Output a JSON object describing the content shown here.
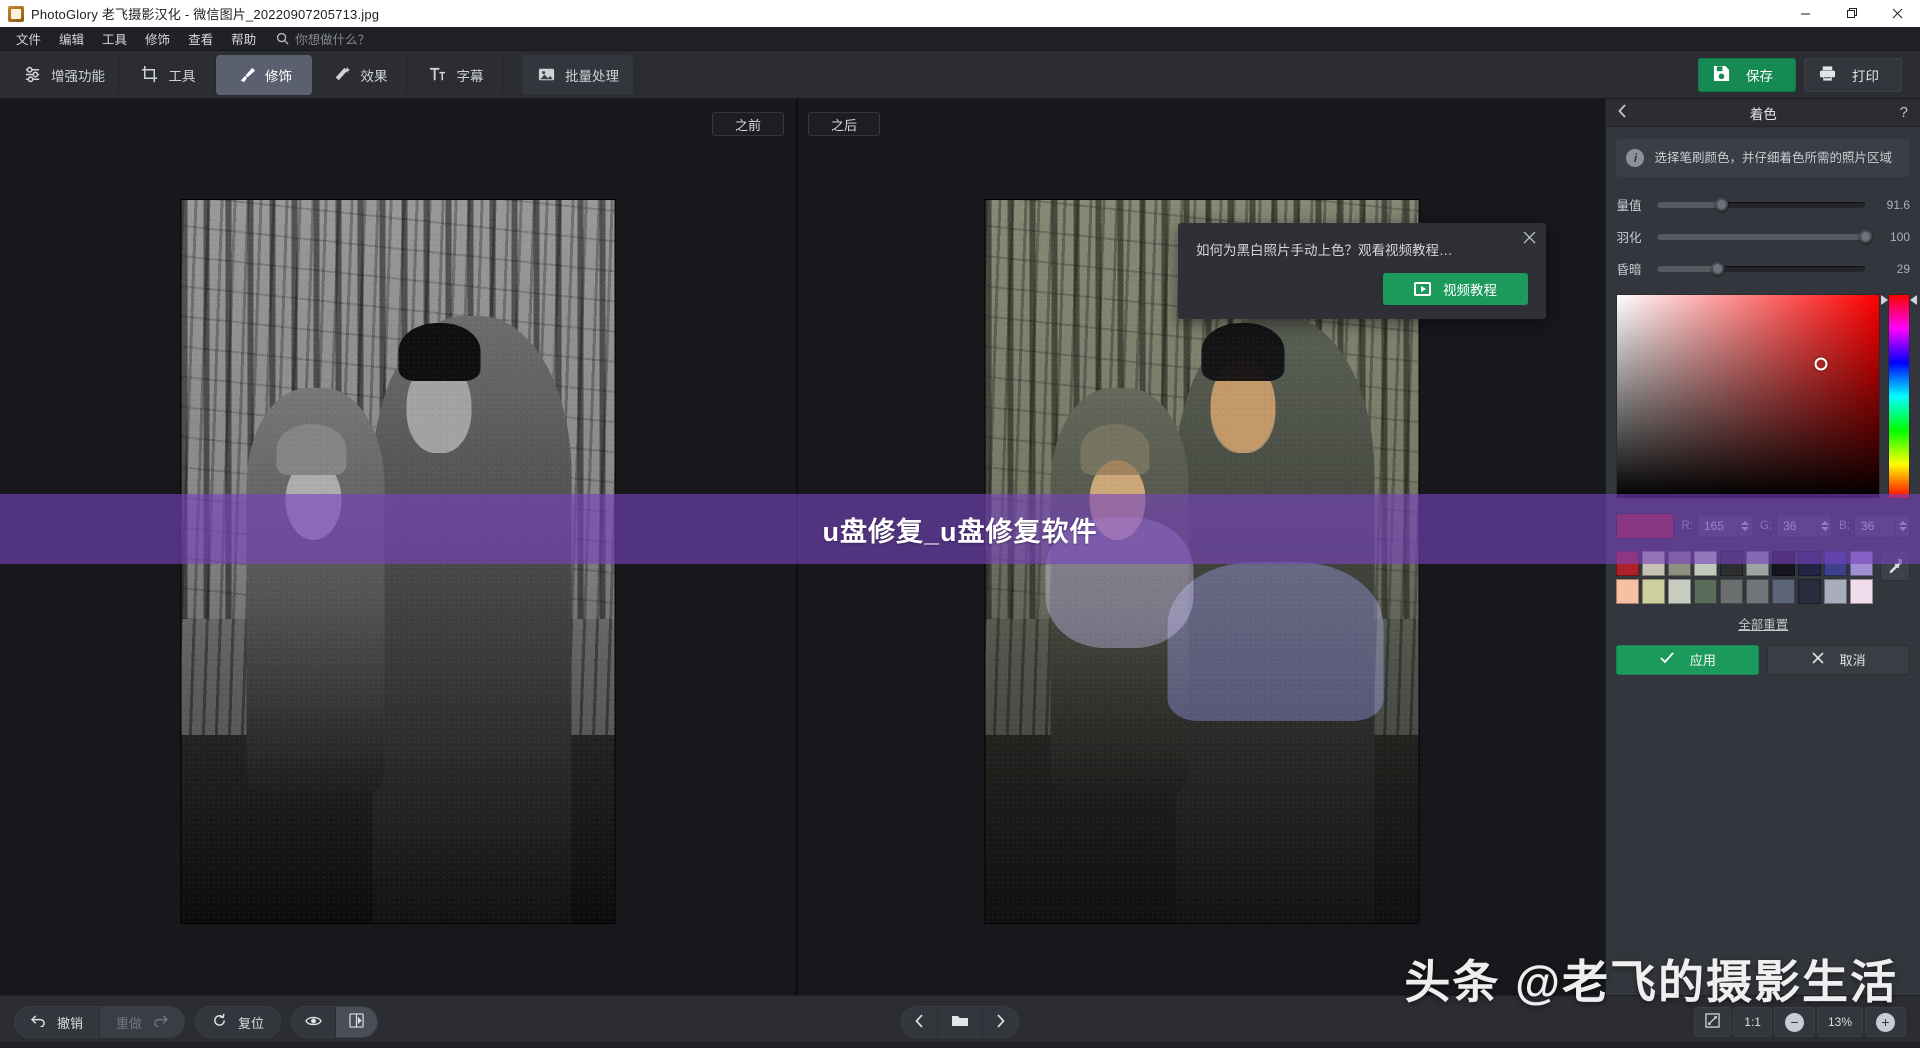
{
  "window": {
    "title": "PhotoGlory 老飞摄影汉化 - 微信图片_20220907205713.jpg",
    "app_icon": "photoglory-icon",
    "minimize": "—",
    "maximize": "❐",
    "close": "✕"
  },
  "menubar": {
    "items": [
      {
        "label": "文件"
      },
      {
        "label": "编辑"
      },
      {
        "label": "工具"
      },
      {
        "label": "修饰"
      },
      {
        "label": "查看"
      },
      {
        "label": "帮助"
      }
    ],
    "search_placeholder": "你想做什么？"
  },
  "ribbon": {
    "tabs": [
      {
        "label": "增强功能",
        "icon": "sliders-icon",
        "active": false
      },
      {
        "label": "工具",
        "icon": "crop-icon",
        "active": false
      },
      {
        "label": "修饰",
        "icon": "brush-icon",
        "active": true
      },
      {
        "label": "效果",
        "icon": "wand-icon",
        "active": false
      },
      {
        "label": "字幕",
        "icon": "text-icon",
        "active": false
      }
    ],
    "batch": {
      "label": "批量处理",
      "icon": "images-icon"
    },
    "save": {
      "label": "保存",
      "icon": "floppy-icon",
      "color": "#168a53"
    },
    "print": {
      "label": "打印",
      "icon": "printer-icon"
    }
  },
  "canvas": {
    "before_label": "之前",
    "after_label": "之后",
    "popup": {
      "text": "如何为黑白照片手动上色？观看视频教程…",
      "button_label": "视频教程",
      "button_icon": "play-video-icon",
      "close_icon": "close-icon"
    }
  },
  "panel": {
    "title": "着色",
    "back_icon": "chevron-left-icon",
    "help_icon": "question-icon",
    "info_text": "选择笔刷颜色，并仔细着色所需的照片区域",
    "info_icon": "info-icon",
    "sliders": [
      {
        "label": "量值",
        "value": "91.6",
        "percent": 31
      },
      {
        "label": "羽化",
        "value": "100",
        "percent": 100
      },
      {
        "label": "昏暗",
        "value": "29",
        "percent": 29
      }
    ],
    "picker": {
      "hue_base": "#ff0000",
      "marker_x_percent": 78,
      "marker_y_percent": 34
    },
    "current_color": "#a52424",
    "channels": [
      {
        "label": "R:",
        "value": "165"
      },
      {
        "label": "G:",
        "value": "36"
      },
      {
        "label": "B:",
        "value": "36"
      }
    ],
    "eyedropper_icon": "eyedropper-icon",
    "swatches_row1": [
      "#b02027",
      "#c5c1b4",
      "#8e9081",
      "#c3cabc",
      "#2c2e30",
      "#9fa3a2",
      "#15161f",
      "#232443",
      "#3f418f",
      "#a08fd2"
    ],
    "swatches_row2": [
      "#f7c0a3",
      "#cdcf9e",
      "#c9cdc0",
      "#5a6b5a",
      "#6b6f70",
      "#707577",
      "#5c6478",
      "#2b2b40",
      "#a8adbc",
      "#f0dcea"
    ],
    "reset_all": "全部重置",
    "apply": {
      "label": "应用",
      "icon": "check-icon"
    },
    "cancel": {
      "label": "取消",
      "icon": "x-icon"
    }
  },
  "bottombar": {
    "undo": {
      "label": "撤销",
      "icon": "undo-arrow-icon"
    },
    "redo": {
      "label": "重做",
      "icon": "redo-arrow-icon",
      "disabled": true
    },
    "reset": {
      "label": "复位",
      "icon": "reset-circle-icon"
    },
    "preview_icon": "eye-icon",
    "compare_icon": "split-compare-icon",
    "prev_icon": "chevron-left-icon",
    "folder_icon": "folder-icon",
    "next_icon": "chevron-right-icon",
    "fit_icon": "fit-screen-icon",
    "actual_size": "1:1",
    "zoom_out": "−",
    "zoom_level": "13%",
    "zoom_in": "+"
  },
  "overlay": {
    "banner_text": "u盘修复_u盘修复软件",
    "banner_color": "#7844be",
    "brand_text": "头条 @老飞的摄影生活"
  }
}
